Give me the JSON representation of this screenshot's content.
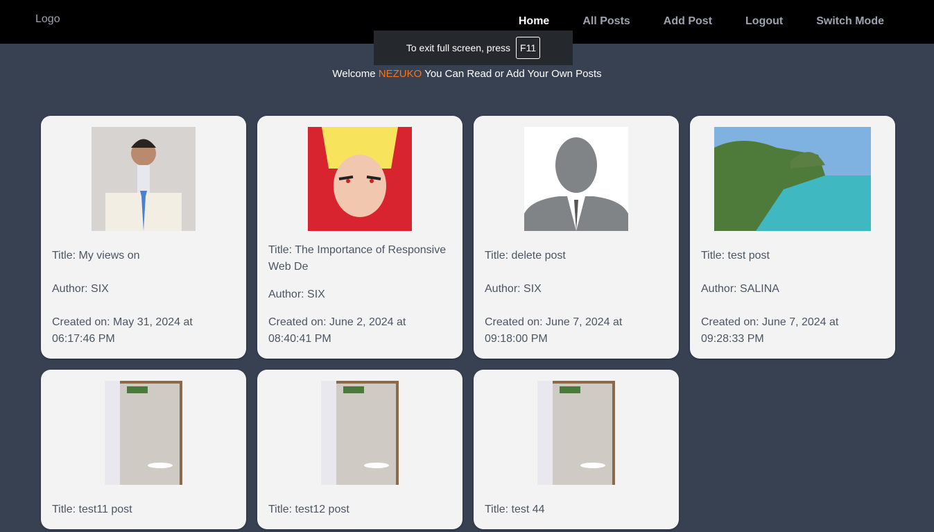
{
  "nav": {
    "logo": "Logo",
    "links": [
      "Home",
      "All Posts",
      "Add Post",
      "Logout",
      "Switch Mode"
    ]
  },
  "fullscreen": {
    "text": "To exit full screen, press",
    "key": "F11"
  },
  "welcome": {
    "prefix": "Welcome",
    "name": "NEZUKO",
    "suffix": "You Can Read or Add Your Own Posts"
  },
  "posts": [
    {
      "title": "Title: My views on",
      "author": "Author: SIX",
      "created": "Created on: May 31, 2024 at 06:17:46 PM",
      "image": "man-portrait"
    },
    {
      "title": "Title: The Importance of Responsive Web De",
      "author": "Author: SIX",
      "created": "Created on: June 2, 2024 at 08:40:41 PM",
      "image": "anime-character"
    },
    {
      "title": "Title: delete post",
      "author": "Author: SIX",
      "created": "Created on: June 7, 2024 at 09:18:00 PM",
      "image": "default-avatar"
    },
    {
      "title": "Title: test post",
      "author": "Author: SALINA",
      "created": "Created on: June 7, 2024 at 09:28:33 PM",
      "image": "coast-landscape"
    },
    {
      "title": "Title: test11 post",
      "image": "document-photo"
    },
    {
      "title": "Title: test12 post",
      "image": "document-photo"
    },
    {
      "title": "Title: test 44",
      "image": "document-photo"
    }
  ]
}
